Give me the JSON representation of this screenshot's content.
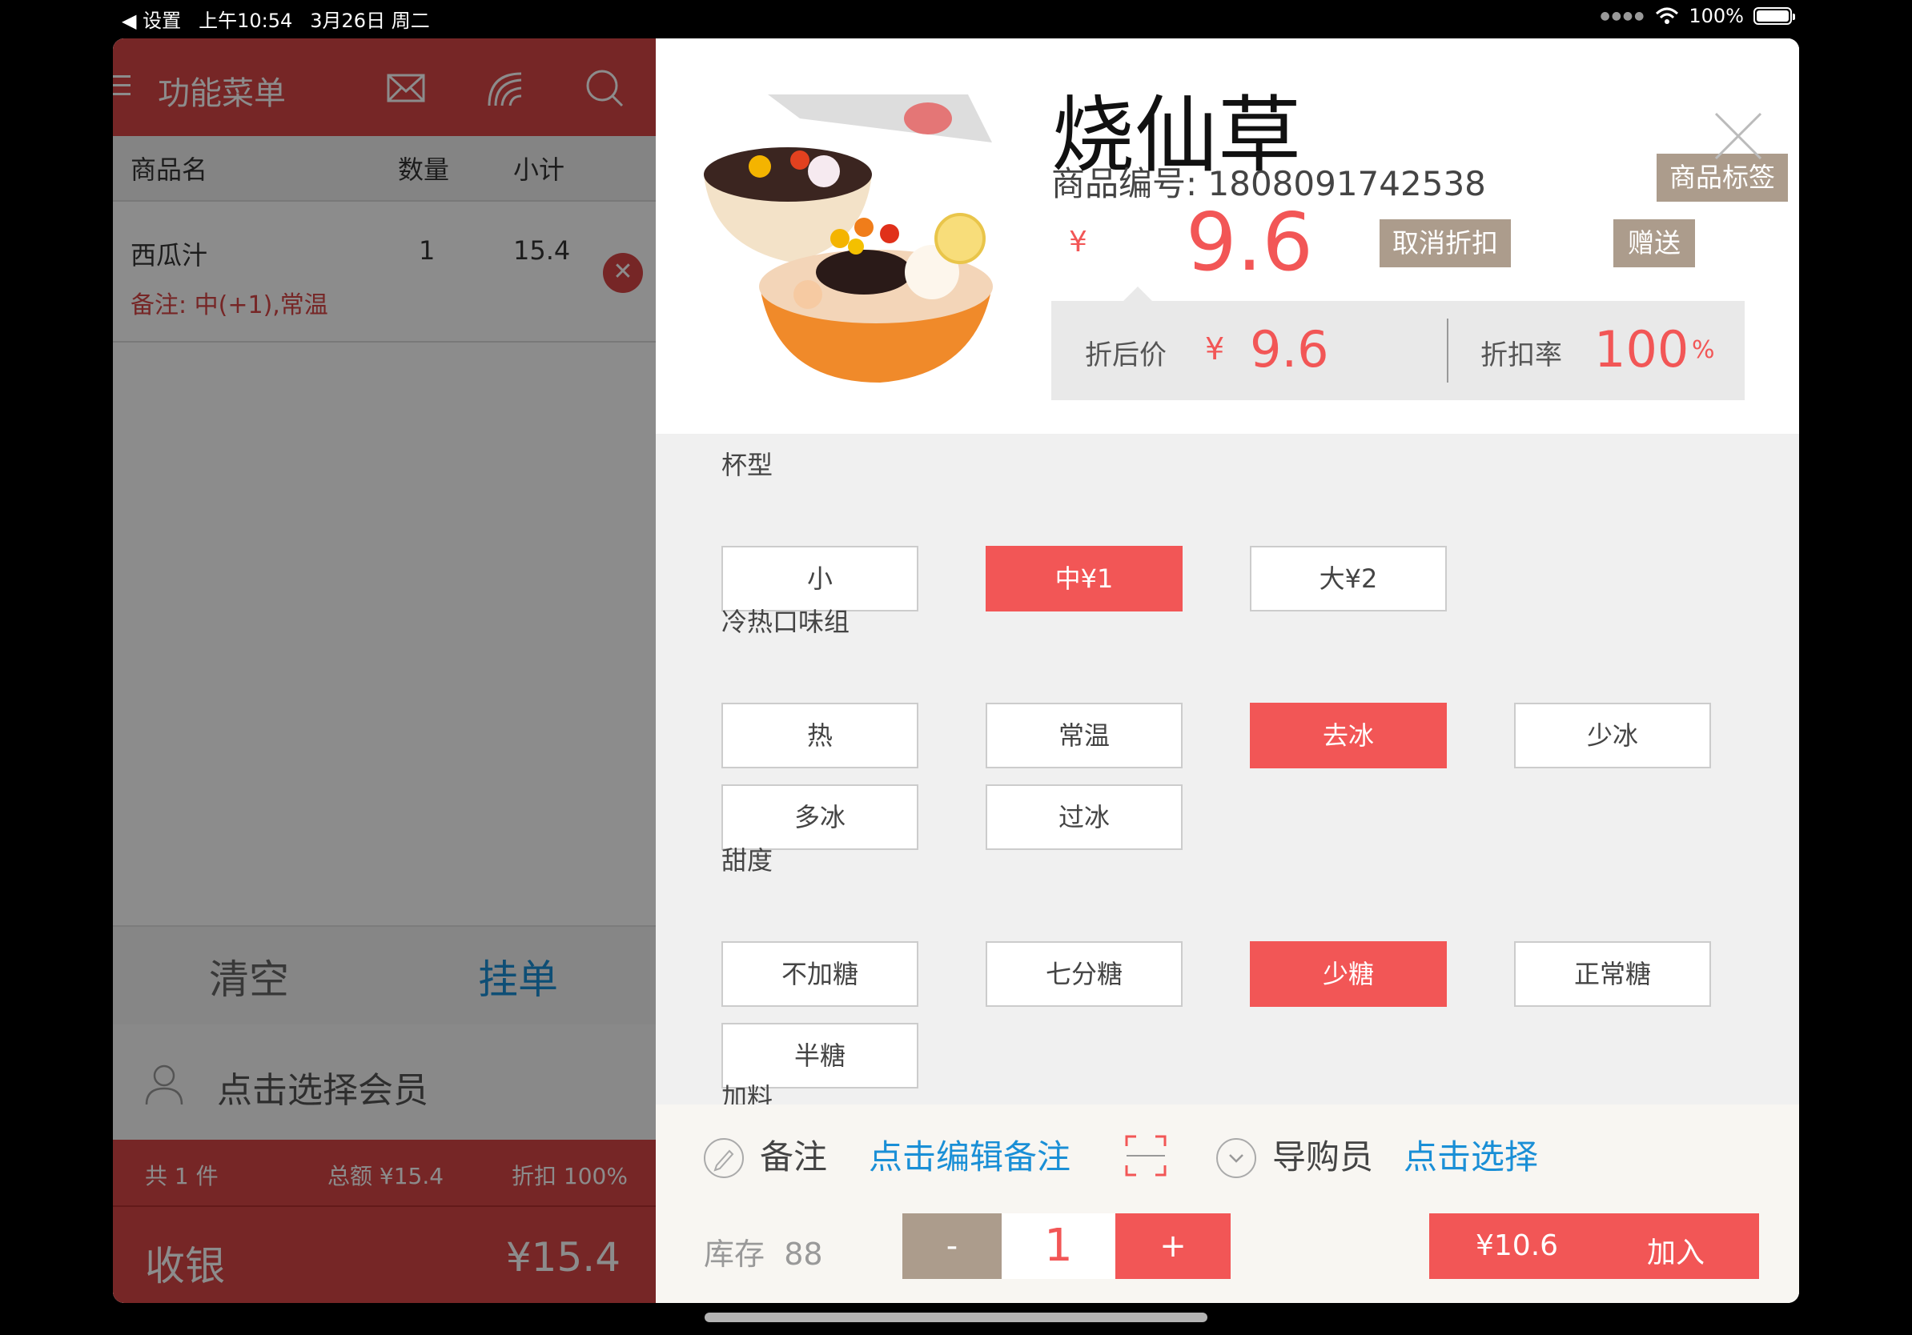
{
  "status": {
    "back_label": "◀ 设置",
    "time": "上午10:54",
    "date": "3月26日 周二",
    "battery": "100%"
  },
  "left": {
    "title": "功能菜单",
    "columns": {
      "name": "商品名",
      "qty": "数量",
      "subtotal": "小计"
    },
    "items": [
      {
        "name": "西瓜汁",
        "qty": "1",
        "subtotal": "15.4",
        "remark": "备注: 中(+1),常温"
      }
    ],
    "clear_label": "清空",
    "hang_label": "挂单",
    "member_placeholder": "点击选择会员",
    "summary": {
      "count": "共 1 件",
      "total": "总额 ¥15.4",
      "discount": "折扣 100%"
    },
    "checkout_label": "收银",
    "checkout_amount": "¥15.4"
  },
  "product": {
    "name": "烧仙草",
    "code": "商品编号: 1808091742538",
    "tag_label": "商品标签",
    "currency": "¥",
    "price": "9.6",
    "cancel_discount_label": "取消折扣",
    "gift_label": "赠送",
    "after_price_label": "折后价",
    "after_price_currency": "¥",
    "after_price": "9.6",
    "discount_rate_label": "折扣率",
    "discount_rate": "100",
    "percent": "%"
  },
  "groups": [
    {
      "label": "杯型",
      "options": [
        "小",
        "中¥1",
        "大¥2"
      ],
      "selected": 1
    },
    {
      "label": "冷热口味组",
      "options": [
        "热",
        "常温",
        "去冰",
        "少冰",
        "多冰",
        "过冰"
      ],
      "selected": 2
    },
    {
      "label": "甜度",
      "options": [
        "不加糖",
        "七分糖",
        "少糖",
        "正常糖",
        "半糖"
      ],
      "selected": 2
    },
    {
      "label": "加料",
      "options": [],
      "selected": -1
    }
  ],
  "bottom": {
    "remark_label": "备注",
    "remark_link": "点击编辑备注",
    "guide_label": "导购员",
    "guide_link": "点击选择",
    "stock_label": "库存",
    "stock_value": "88",
    "minus": "-",
    "qty": "1",
    "plus": "+",
    "add_price": "¥10.6",
    "add_label": "加入"
  },
  "colors": {
    "accent": "#f25656",
    "header_red": "#d84546",
    "tag": "#ac9c8c",
    "link": "#1a8fd6"
  }
}
